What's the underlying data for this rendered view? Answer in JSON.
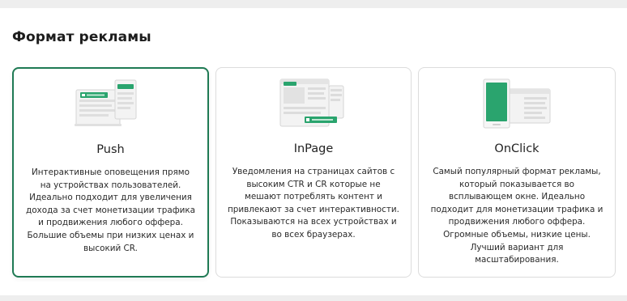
{
  "section": {
    "title": "Формат рекламы"
  },
  "colors": {
    "accent": "#2aa46e",
    "selected_border": "#1f7a54"
  },
  "cards": [
    {
      "id": "push",
      "title": "Push",
      "icon": "push-notification-illustration-icon",
      "selected": true,
      "description": "Интерактивные оповещения прямо на устройствах пользователей. Идеально подходит для увеличения дохода за счет монетизации трафика и продвижения любого оффера. Большие объемы при низких ценах и высокий CR."
    },
    {
      "id": "inpage",
      "title": "InPage",
      "icon": "inpage-notification-illustration-icon",
      "selected": false,
      "description": "Уведомления на страницах сайтов с высоким CTR и CR которые не мешают потреблять контент и привлекают за счет интерактивности. Показываются на всех устройствах и во всех браузерах."
    },
    {
      "id": "onclick",
      "title": "OnClick",
      "icon": "onclick-popunder-illustration-icon",
      "selected": false,
      "description": "Самый популярный формат рекламы, который показывается во всплывающем окне. Идеально подходит для монетизации трафика и продвижения любого оффера. Огромные объемы, низкие цены. Лучший вариант для масштабирования."
    }
  ]
}
